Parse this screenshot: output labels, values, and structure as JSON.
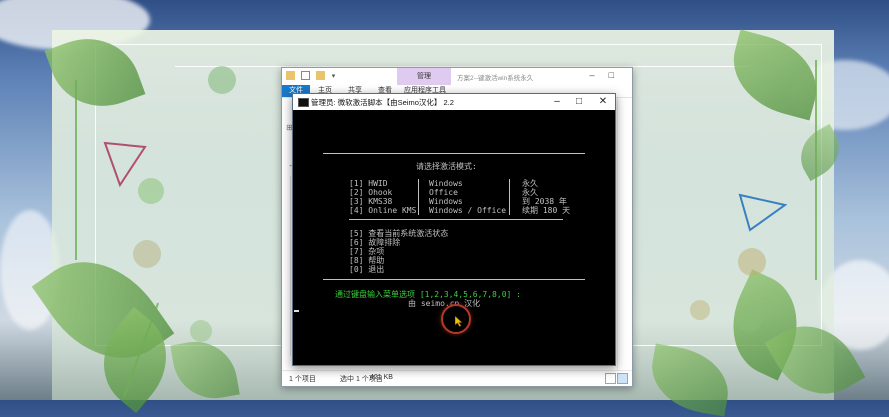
{
  "explorer": {
    "manage_tab": "管理",
    "title": "方案2--键激活win系统永久",
    "ribbon_tabs": [
      "文件",
      "主页",
      "共享",
      "查看",
      "应用程序工具"
    ],
    "status_count": "1 个项目",
    "status_selected": "选中 1 个项目",
    "status_size": "421 KB"
  },
  "console": {
    "title": "管理员:  微软激活脚本【由Seimo汉化】 2.2",
    "prompt_title": "请选择激活模式:",
    "options": [
      {
        "key": "[1] HWID",
        "product": "Windows",
        "duration": "永久"
      },
      {
        "key": "[2] Ohook",
        "product": "Office",
        "duration": "永久"
      },
      {
        "key": "[3] KMS38",
        "product": "Windows",
        "duration": "到 2038 年"
      },
      {
        "key": "[4] Online KMS",
        "product": "Windows / Office",
        "duration": "续期 180 天"
      }
    ],
    "extras": [
      "[5] 查看当前系统激活状态",
      "[6] 故障排除",
      "[7] 杂项",
      "[8] 帮助",
      "[0] 退出"
    ],
    "input_prompt": "通过键盘输入菜单选项 [1,2,3,4,5,6,7,8,0] :",
    "credit": "由 seimo.cn 汉化"
  },
  "icons": {
    "console_icon": "terminal-icon",
    "minimize": "minimize-icon",
    "maximize": "maximize-icon",
    "close": "close-icon",
    "cursor": "mouse-pointer-icon"
  },
  "colors": {
    "console_bg": "#000000",
    "console_text": "#c0c0c0",
    "prompt_green": "#3cd23c",
    "manage_tab": "#e0cbf0",
    "file_tab": "#1979ca"
  }
}
